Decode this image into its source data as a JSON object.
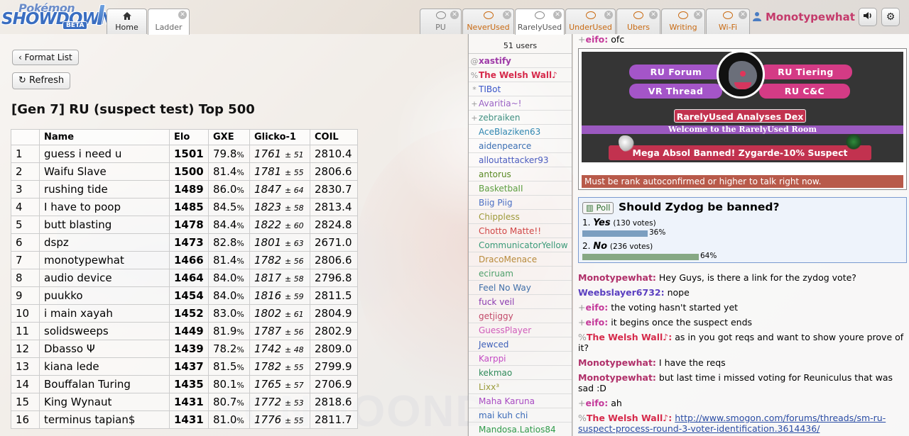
{
  "app": {
    "logo_top": "Pokémon",
    "logo_main": "SHOWDOWN",
    "logo_badge": "BETA"
  },
  "main_tabs": [
    {
      "label": "Home",
      "icon": "home-icon"
    },
    {
      "label": "Ladder",
      "icon": "none"
    }
  ],
  "room_tabs": [
    {
      "label": "PU",
      "icon": "chat-bubble-icon"
    },
    {
      "label": "NeverUsed",
      "icon": "chat-bubble-icon"
    },
    {
      "label": "RarelyUsed",
      "icon": "chat-bubble-icon"
    },
    {
      "label": "UnderUsed",
      "icon": "chat-bubble-icon"
    },
    {
      "label": "Ubers",
      "icon": "chat-bubble-icon"
    },
    {
      "label": "Writing",
      "icon": "chat-bubble-icon"
    },
    {
      "label": "Wi-Fi",
      "icon": "chat-bubble-icon"
    }
  ],
  "user": {
    "name": "Monotypewhat"
  },
  "ladder": {
    "format_list_label": "Format List",
    "refresh_label": "Refresh",
    "title": "[Gen 7] RU (suspect test) Top 500",
    "columns": [
      "",
      "Name",
      "Elo",
      "GXE",
      "Glicko-1",
      "COIL"
    ],
    "rows": [
      {
        "rank": "1",
        "name": "guess i need u",
        "elo": "1501",
        "gxe": "79.8",
        "glicko": "1761",
        "dev": "51",
        "coil": "2810.4"
      },
      {
        "rank": "2",
        "name": "Waifu Slave",
        "elo": "1500",
        "gxe": "81.4",
        "glicko": "1781",
        "dev": "55",
        "coil": "2806.6"
      },
      {
        "rank": "3",
        "name": "rushing tide",
        "elo": "1489",
        "gxe": "86.0",
        "glicko": "1847",
        "dev": "64",
        "coil": "2830.7"
      },
      {
        "rank": "4",
        "name": "I have to poop",
        "elo": "1485",
        "gxe": "84.5",
        "glicko": "1823",
        "dev": "58",
        "coil": "2813.4"
      },
      {
        "rank": "5",
        "name": "butt blasting",
        "elo": "1478",
        "gxe": "84.4",
        "glicko": "1822",
        "dev": "60",
        "coil": "2824.8"
      },
      {
        "rank": "6",
        "name": "dspz",
        "elo": "1473",
        "gxe": "82.8",
        "glicko": "1801",
        "dev": "63",
        "coil": "2671.0"
      },
      {
        "rank": "7",
        "name": "monotypewhat",
        "elo": "1466",
        "gxe": "81.4",
        "glicko": "1782",
        "dev": "56",
        "coil": "2806.6"
      },
      {
        "rank": "8",
        "name": "audio device",
        "elo": "1464",
        "gxe": "84.0",
        "glicko": "1817",
        "dev": "58",
        "coil": "2796.8"
      },
      {
        "rank": "9",
        "name": "puukko",
        "elo": "1454",
        "gxe": "84.0",
        "glicko": "1816",
        "dev": "59",
        "coil": "2811.5"
      },
      {
        "rank": "10",
        "name": "i main xayah",
        "elo": "1452",
        "gxe": "83.0",
        "glicko": "1802",
        "dev": "61",
        "coil": "2804.9"
      },
      {
        "rank": "11",
        "name": "solidsweeps",
        "elo": "1449",
        "gxe": "81.9",
        "glicko": "1787",
        "dev": "56",
        "coil": "2802.9"
      },
      {
        "rank": "12",
        "name": "Dbasso Ψ",
        "elo": "1439",
        "gxe": "78.2",
        "glicko": "1742",
        "dev": "48",
        "coil": "2809.0"
      },
      {
        "rank": "13",
        "name": "kiana lede",
        "elo": "1437",
        "gxe": "81.5",
        "glicko": "1782",
        "dev": "55",
        "coil": "2799.9"
      },
      {
        "rank": "14",
        "name": "Bouffalan Turing",
        "elo": "1435",
        "gxe": "80.1",
        "glicko": "1765",
        "dev": "57",
        "coil": "2706.9"
      },
      {
        "rank": "15",
        "name": "King Wynaut",
        "elo": "1431",
        "gxe": "80.7",
        "glicko": "1772",
        "dev": "53",
        "coil": "2818.6"
      },
      {
        "rank": "16",
        "name": "terminus tapian$",
        "elo": "1431",
        "gxe": "81.0",
        "glicko": "1776",
        "dev": "55",
        "coil": "2811.7"
      }
    ]
  },
  "userlist": {
    "count": "51 users",
    "users": [
      {
        "rank": "@",
        "name": "xastify",
        "color": "#9e3aa8",
        "bold": true
      },
      {
        "rank": "%",
        "name": "The Welsh Wall♪",
        "color": "#d62a4b",
        "bold": true
      },
      {
        "rank": "*",
        "name": "TIBot",
        "color": "#3a55c8",
        "bold": false
      },
      {
        "rank": "+",
        "name": "Avaritia~!",
        "color": "#9a62c4",
        "bold": false
      },
      {
        "rank": "+",
        "name": "zebraiken",
        "color": "#3f8f80",
        "bold": false
      },
      {
        "rank": "",
        "name": "AceBlaziken63",
        "color": "#2f86b0",
        "bold": false
      },
      {
        "rank": "",
        "name": "aidenpearce",
        "color": "#3c6fb3",
        "bold": false
      },
      {
        "rank": "",
        "name": "alloutattacker93",
        "color": "#4b5cbf",
        "bold": false
      },
      {
        "rank": "",
        "name": "antorus",
        "color": "#5a8a24",
        "bold": false
      },
      {
        "rank": "",
        "name": "BasketbaII",
        "color": "#5d9e40",
        "bold": false
      },
      {
        "rank": "",
        "name": "Biig Piig",
        "color": "#4a6fc4",
        "bold": false
      },
      {
        "rank": "",
        "name": "Chippless",
        "color": "#9e9a3a",
        "bold": false
      },
      {
        "rank": "",
        "name": "Chotto Matte!!",
        "color": "#d04646",
        "bold": false
      },
      {
        "rank": "",
        "name": "CommunicatorYellow",
        "color": "#3a9a78",
        "bold": false
      },
      {
        "rank": "",
        "name": "DracoMenace",
        "color": "#b88a3a",
        "bold": false
      },
      {
        "rank": "",
        "name": "eciruam",
        "color": "#4fa06c",
        "bold": false
      },
      {
        "rank": "",
        "name": "Feel No Way",
        "color": "#3f6ea8",
        "bold": false
      },
      {
        "rank": "",
        "name": "fuck veil",
        "color": "#8a3ab0",
        "bold": false
      },
      {
        "rank": "",
        "name": "getjiggy",
        "color": "#c24a6a",
        "bold": false
      },
      {
        "rank": "",
        "name": "GuessPlayer",
        "color": "#d05cba",
        "bold": false
      },
      {
        "rank": "",
        "name": "Jewced",
        "color": "#3c5eb8",
        "bold": false
      },
      {
        "rank": "",
        "name": "Karppi",
        "color": "#c44ac4",
        "bold": false
      },
      {
        "rank": "",
        "name": "kekmao",
        "color": "#2f8a5a",
        "bold": false
      },
      {
        "rank": "",
        "name": "Lixx³",
        "color": "#9a9a3a",
        "bold": false
      },
      {
        "rank": "",
        "name": "Maha Karuna",
        "color": "#a84ac2",
        "bold": false
      },
      {
        "rank": "",
        "name": "mai kuh chi",
        "color": "#3a6ab8",
        "bold": false
      },
      {
        "rank": "",
        "name": "Mandosa.Latios84",
        "color": "#2f9a4a",
        "bold": false
      }
    ]
  },
  "chat": {
    "top_partial": {
      "group": "+",
      "name": "eifo:",
      "text": "ofc",
      "color": "#c43a9a"
    },
    "banner": {
      "pill_forum": "RU Forum",
      "pill_tiering": "RU Tiering",
      "pill_vr": "VR Thread",
      "pill_cc": "RU C&C",
      "dex_label": "RarelyUsed Analyses Dex",
      "welcome": "Welcome to the RarelyUsed Room",
      "ban_notice": "Mega Absol Banned! Zygarde-10% Suspect"
    },
    "notice": "Must be rank autoconfirmed or higher to talk right now.",
    "poll": {
      "badge": "Poll",
      "question": "Should Zydog be banned?",
      "options": [
        {
          "num": "1.",
          "label": "Yes",
          "votes": "(130 votes)",
          "percent": 36,
          "percent_label": "36%",
          "color": "#7b9ec0"
        },
        {
          "num": "2.",
          "label": "No",
          "votes": "(236 votes)",
          "percent": 64,
          "percent_label": "64%",
          "color": "#86a884"
        }
      ]
    },
    "messages": [
      {
        "group": "",
        "name": "Monotypewhat:",
        "color": "#b0306a",
        "text": "Hey Guys, is there a link for the zydog vote?"
      },
      {
        "group": "",
        "name": "Weebslayer6732:",
        "color": "#5a3fc0",
        "text": "nope"
      },
      {
        "group": "+",
        "name": "eifo:",
        "color": "#c43a9a",
        "text": "the voting hasn't started yet"
      },
      {
        "group": "+",
        "name": "eifo:",
        "color": "#c43a9a",
        "text": "it begins once the suspect ends"
      },
      {
        "group": "%",
        "name": "The Welsh Wall♪:",
        "color": "#d62a4b",
        "text": "as in you got reqs and want to show youre prove of it?"
      },
      {
        "group": "",
        "name": "Monotypewhat:",
        "color": "#b0306a",
        "text": "I have the reqs"
      },
      {
        "group": "",
        "name": "Monotypewhat:",
        "color": "#b0306a",
        "text": "but last time i missed voting for Reuniculus that was sad :D"
      },
      {
        "group": "+",
        "name": "eifo:",
        "color": "#c43a9a",
        "text": "ah"
      },
      {
        "group": "%",
        "name": "The Welsh Wall♪:",
        "color": "#d62a4b",
        "text": "http://www.smogon.com/forums/threads/sm-ru-suspect-process-round-3-voter-identification.3614436/",
        "link": true
      }
    ]
  }
}
